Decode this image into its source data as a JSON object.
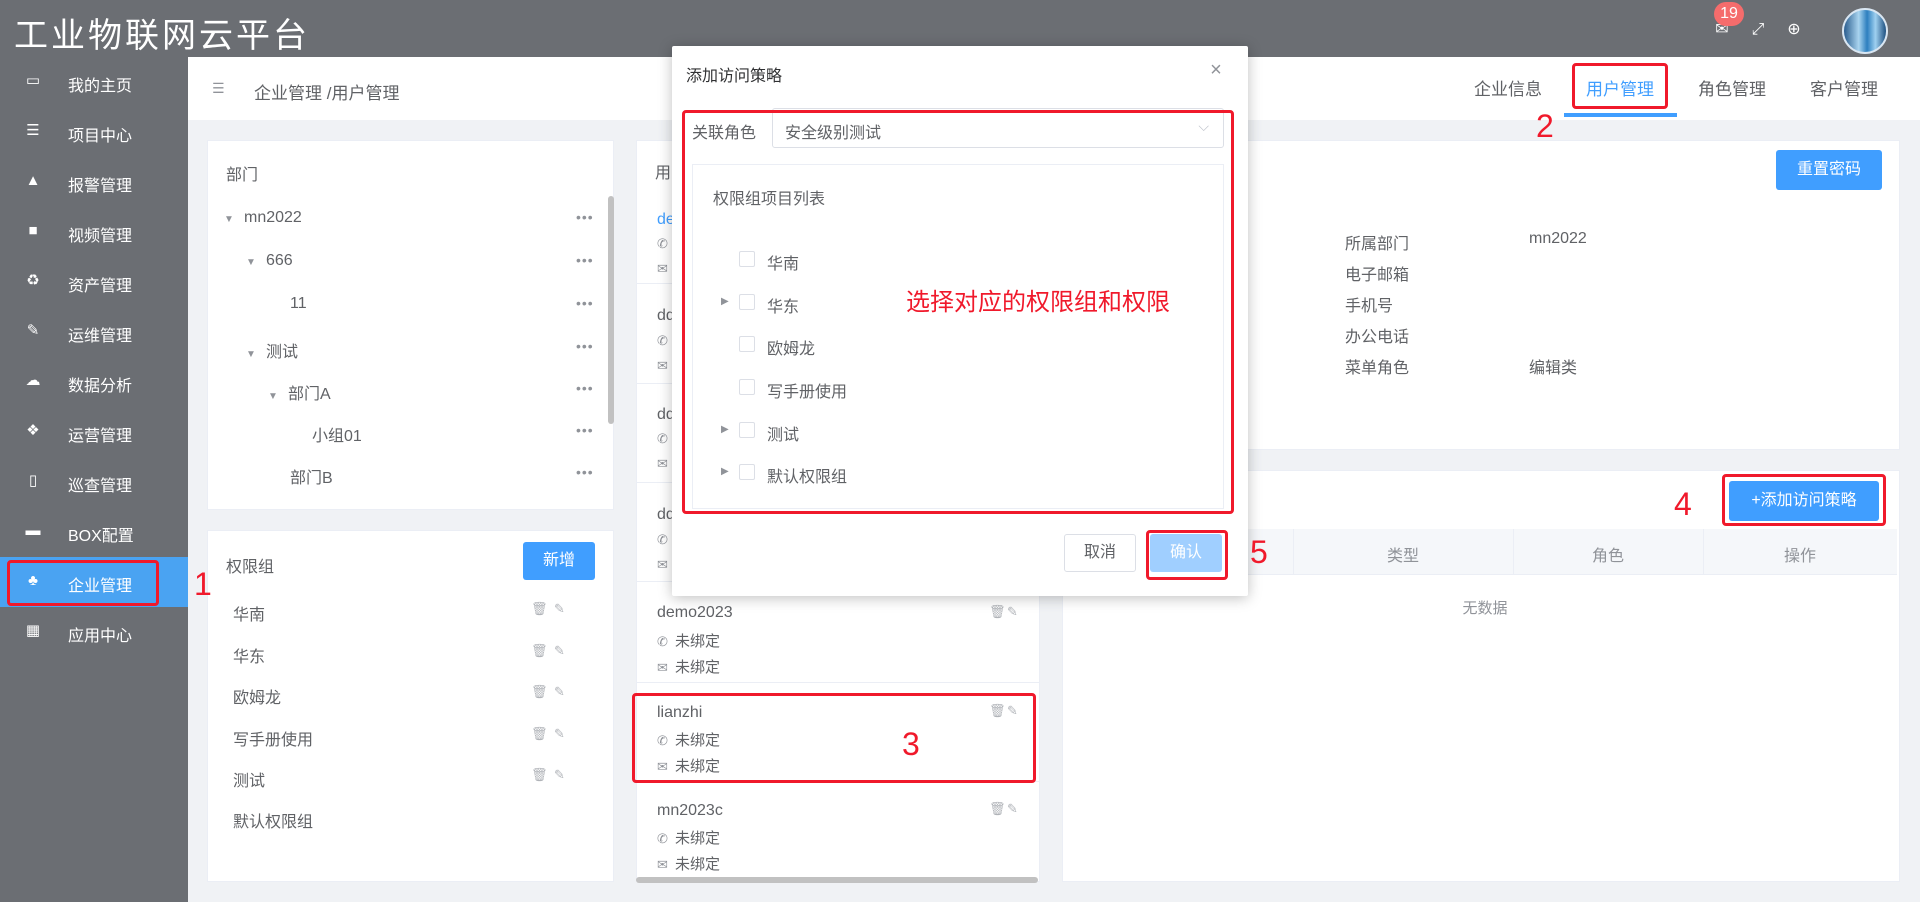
{
  "app": {
    "title": "工业物联网云平台",
    "badge_count": "19"
  },
  "sidebar": {
    "items": [
      {
        "label": "我的主页",
        "icon": "laptop-icon"
      },
      {
        "label": "项目中心",
        "icon": "list-icon"
      },
      {
        "label": "报警管理",
        "icon": "bell-icon"
      },
      {
        "label": "视频管理",
        "icon": "video-icon"
      },
      {
        "label": "资产管理",
        "icon": "recycle-icon"
      },
      {
        "label": "运维管理",
        "icon": "wrench-icon"
      },
      {
        "label": "数据分析",
        "icon": "cloud-chart-icon"
      },
      {
        "label": "运营管理",
        "icon": "cubes-icon"
      },
      {
        "label": "巡查管理",
        "icon": "file-icon"
      },
      {
        "label": "BOX配置",
        "icon": "monitor-icon"
      },
      {
        "label": "企业管理",
        "icon": "sitemap-icon"
      },
      {
        "label": "应用中心",
        "icon": "grid-icon"
      }
    ],
    "active_index": 10
  },
  "breadcrumb": "企业管理 /用户管理",
  "tabs": [
    "企业信息",
    "用户管理",
    "角色管理",
    "客户管理"
  ],
  "dept": {
    "title": "部门",
    "rows": [
      "mn2022",
      "666",
      "11",
      "测试",
      "部门A",
      "小组01",
      "部门B"
    ]
  },
  "perm_groups": {
    "title": "权限组",
    "add_label": "新增",
    "items": [
      "华南",
      "华东",
      "欧姆龙",
      "写手册使用",
      "测试",
      "默认权限组"
    ]
  },
  "users": {
    "title_partial": "用",
    "partial_names": [
      "de",
      "dd",
      "dd",
      "dd"
    ],
    "cards": [
      {
        "name": "demo2023",
        "phone": "未绑定",
        "email": "未绑定"
      },
      {
        "name": "lianzhi",
        "phone": "未绑定",
        "email": "未绑定"
      },
      {
        "name": "mn2023c",
        "phone": "未绑定",
        "email": "未绑定"
      }
    ]
  },
  "info": {
    "reset_label": "重置密码",
    "labels": [
      "所属部门",
      "电子邮箱",
      "手机号",
      "办公电话",
      "菜单角色"
    ],
    "values": [
      "mn2022",
      "",
      "",
      "",
      "编辑类"
    ]
  },
  "policy": {
    "add_label": "+添加访问策略",
    "columns": [
      "类型",
      "角色",
      "操作"
    ],
    "empty": "无数据"
  },
  "dialog": {
    "title": "添加访问策略",
    "select_label": "关联角色",
    "select_value": "安全级别测试",
    "list_title": "权限组项目列表",
    "items": [
      {
        "label": "华南",
        "expandable": false
      },
      {
        "label": "华东",
        "expandable": true
      },
      {
        "label": "欧姆龙",
        "expandable": false
      },
      {
        "label": "写手册使用",
        "expandable": false
      },
      {
        "label": "测试",
        "expandable": true
      },
      {
        "label": "默认权限组",
        "expandable": true
      }
    ],
    "cancel_label": "取消",
    "confirm_label": "确认"
  },
  "annotations": {
    "note": "选择对应的权限组和权限",
    "n1": "1",
    "n2": "2",
    "n3": "3",
    "n4": "4",
    "n5": "5"
  },
  "colors": {
    "primary": "#409eff",
    "sidebar": "#6b6e73",
    "annotation": "#f0192b"
  }
}
